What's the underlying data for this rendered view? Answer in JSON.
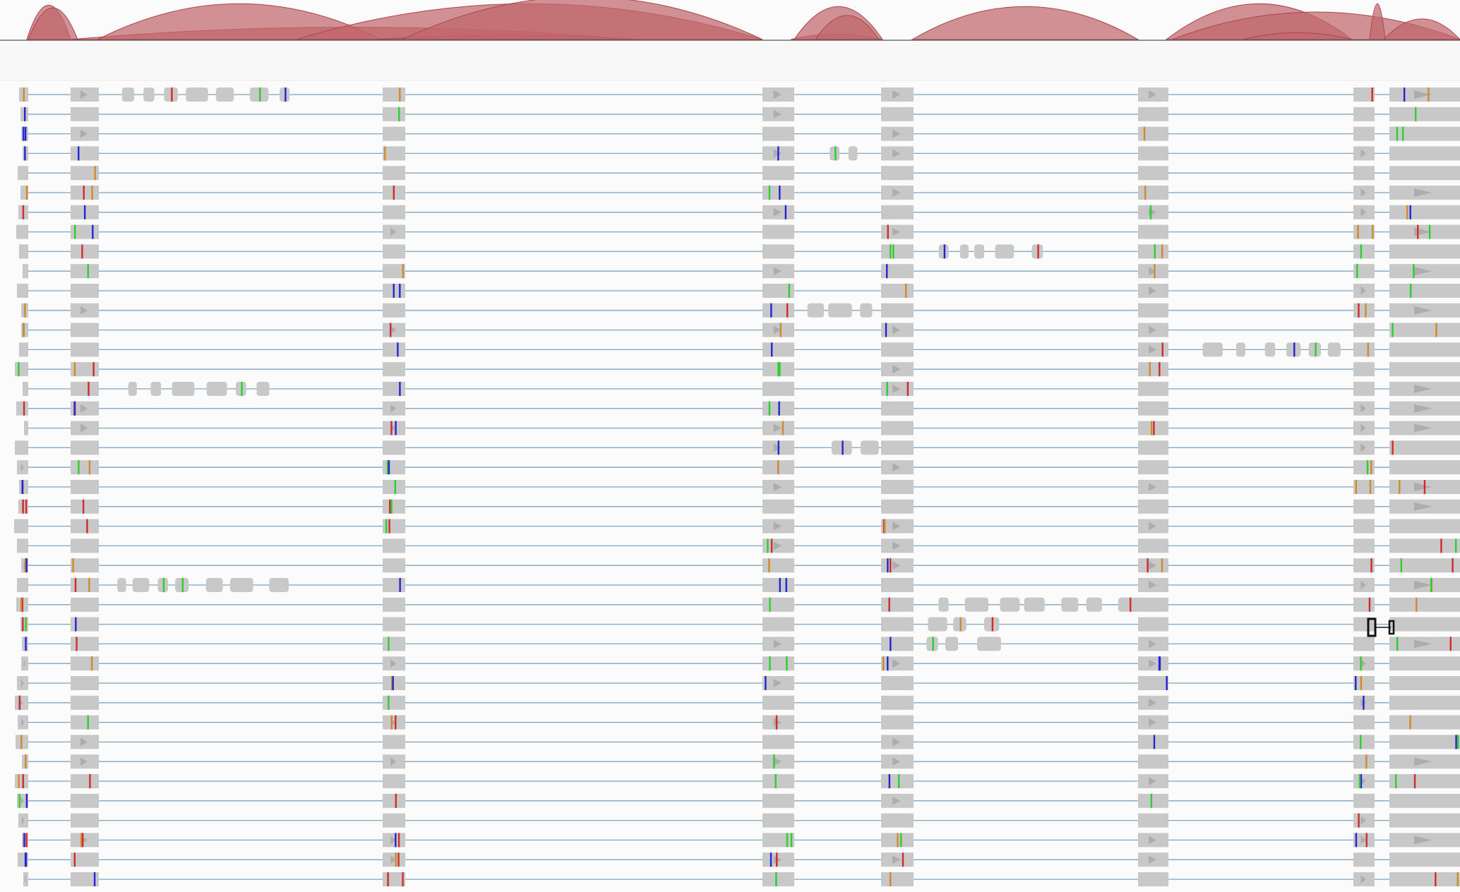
{
  "colors": {
    "arc_fill": "#c0676c",
    "arc_stroke": "#a8474d",
    "exon_block": "#c8c8c8",
    "intron_line": "#7ea4c4",
    "background": "#fbfbfb",
    "mismatch_A": "#2bd02b",
    "mismatch_C": "#2424d6",
    "mismatch_G": "#d08a2a",
    "mismatch_T": "#d42a2a"
  }
}
